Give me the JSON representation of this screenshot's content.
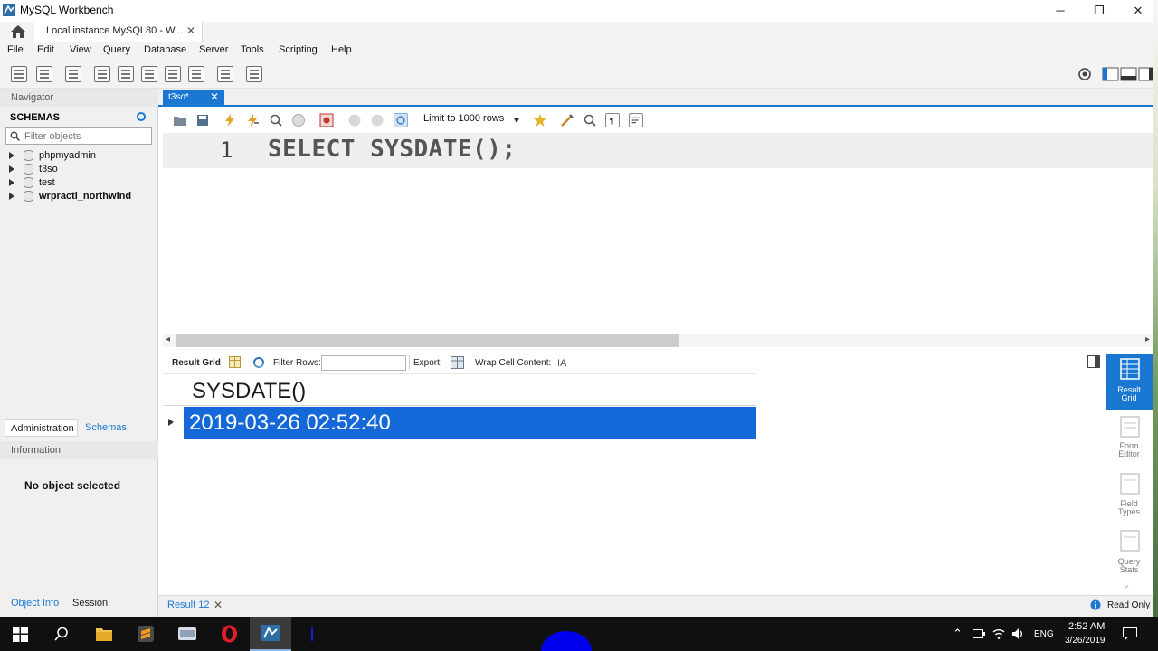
{
  "window": {
    "title": "MySQL Workbench",
    "minimize": "─",
    "maximize": "❐",
    "close": "✕"
  },
  "tabs": {
    "connection_label": "Local instance MySQL80 - W...",
    "close": "✕"
  },
  "menu": [
    "File",
    "Edit",
    "View",
    "Query",
    "Database",
    "Server",
    "Tools",
    "Scripting",
    "Help"
  ],
  "sidebar": {
    "navigator_header": "Navigator",
    "schemas_title": "SCHEMAS",
    "filter_placeholder": "Filter objects",
    "schemas": [
      {
        "name": "phpmyadmin",
        "bold": false
      },
      {
        "name": "t3so",
        "bold": false
      },
      {
        "name": "test",
        "bold": false
      },
      {
        "name": "wrpracti_northwind",
        "bold": true
      }
    ],
    "tab_administration": "Administration",
    "tab_schemas": "Schemas",
    "information_header": "Information",
    "no_object": "No object selected",
    "tab_object_info": "Object Info",
    "tab_session": "Session"
  },
  "editor": {
    "tab_label": "t3so*",
    "tab_close": "✕",
    "limit_label": "Limit to 1000 rows",
    "line_number": "1",
    "sql": "SELECT SYSDATE();"
  },
  "result_toolbar": {
    "result_grid": "Result Grid",
    "filter_rows": "Filter Rows:",
    "export": "Export:",
    "wrap": "Wrap Cell Content:"
  },
  "result": {
    "column": "SYSDATE()",
    "rows": [
      "2019-03-26 02:52:40"
    ],
    "tab_label": "Result 12",
    "tab_close": "✕",
    "read_only": "Read Only"
  },
  "right_panel": {
    "result_grid": [
      "Result",
      "Grid"
    ],
    "form_editor": [
      "Form",
      "Editor"
    ],
    "field_types": [
      "Field",
      "Types"
    ],
    "query_stats": [
      "Query",
      "Stats"
    ]
  },
  "taskbar": {
    "lang": "ENG",
    "time": "2:52 AM",
    "date": "3/26/2019"
  },
  "colors": {
    "accent": "#1a78d2",
    "selection": "#1468d8"
  }
}
